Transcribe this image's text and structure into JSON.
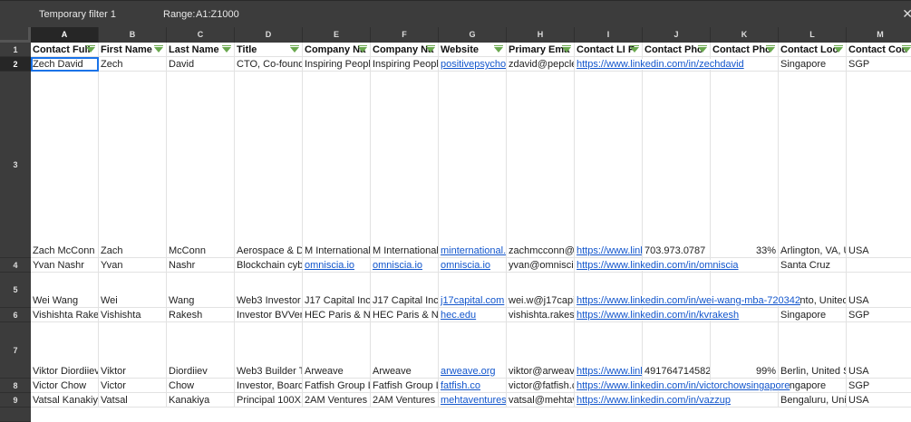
{
  "filter_bar": {
    "name": "Temporary filter 1",
    "range_label": "Range:",
    "range_value": "A1:Z1000",
    "close_icon": "close-icon"
  },
  "columns": [
    "A",
    "B",
    "C",
    "D",
    "E",
    "F",
    "G",
    "H",
    "I",
    "J",
    "K",
    "L",
    "M"
  ],
  "selected_column": "A",
  "selected_row": "2",
  "colors": {
    "link": "#1155cc",
    "filter_icon": "#6aa84f",
    "selection": "#1a73e8",
    "header_bg": "#3c3c3c"
  },
  "headers": [
    "Contact Full",
    "First Name",
    "Last Name",
    "Title",
    "Company Na",
    "Company Na",
    "Website",
    "Primary Ema",
    "Contact LI P",
    "Contact Pho",
    "Contact Pho",
    "Contact Loc",
    "Contact Cou"
  ],
  "rows": [
    {
      "num": "2",
      "cells": [
        "Zech David",
        "Zech",
        "David",
        "CTO, Co-founde",
        "Inspiring People",
        "Inspiring People",
        "positivepsycholo",
        "zdavid@pepclev",
        "https://www.linkedin.com/in/zechdavid",
        "",
        "",
        "Singapore",
        "SGP"
      ]
    },
    {
      "num": "3",
      "cells": [
        "Zach McConn",
        "Zach",
        "McConn",
        "Aerospace & De",
        "M International I",
        "M International I",
        "minternational.co",
        "zachmcconn@m",
        "https://www.linke",
        "703.973.0787",
        "33%",
        "Arlington, VA, Ur",
        "USA"
      ]
    },
    {
      "num": "4",
      "cells": [
        "Yvan Nashr",
        "Yvan",
        "Nashr",
        "Blockchain cybe",
        "omniscia.io",
        "omniscia.io",
        "omniscia.io",
        "yvan@omniscia.",
        "https://www.linkedin.com/in/omniscia",
        "",
        "",
        "Santa Cruz",
        ""
      ]
    },
    {
      "num": "5",
      "cells": [
        "Wei Wang",
        "Wei",
        "Wang",
        "Web3 Investor",
        "J17 Capital Inc.",
        "J17 Capital Inc.",
        "j17capital.com",
        "wei.w@j17capita",
        "https://www.linkedin.com/in/wei-wang-mba-720342",
        "",
        "",
        "Toronto, United S",
        "USA"
      ]
    },
    {
      "num": "6",
      "cells": [
        "Vishishta Rakesh",
        "Vishishta",
        "Rakesh",
        "Investor BVVentu",
        "HEC Paris & NU",
        "HEC Paris & NU",
        "hec.edu",
        "vishishta.rakesh",
        "https://www.linkedin.com/in/kvrakesh",
        "",
        "",
        "Singapore",
        "SGP"
      ]
    },
    {
      "num": "7",
      "cells": [
        "Viktor Diordiiev",
        "Viktor",
        "Diordiiev",
        "Web3 Builder To",
        "Arweave",
        "Arweave",
        "arweave.org",
        "viktor@arweave",
        "https://www.linke",
        "4917647145826",
        "99%",
        "Berlin, United St",
        "USA"
      ]
    },
    {
      "num": "8",
      "cells": [
        "Victor Chow",
        "Victor",
        "Chow",
        "Investor, Board M",
        "Fatfish Group Lin",
        "Fatfish Group Lin",
        "fatfish.co",
        "victor@fatfish.co",
        "https://www.linkedin.com/in/victorchowsingapore",
        "",
        "",
        "Singapore",
        "SGP"
      ]
    },
    {
      "num": "9",
      "cells": [
        "Vatsal Kanakiya",
        "Vatsal",
        "Kanakiya",
        "Principal 100X.V",
        "2AM Ventures &",
        "2AM Ventures &",
        "mehtaventures.c",
        "vatsal@mehtave",
        "https://www.linkedin.com/in/vazzup",
        "",
        "",
        "Bengaluru, Unite",
        "USA"
      ]
    }
  ]
}
